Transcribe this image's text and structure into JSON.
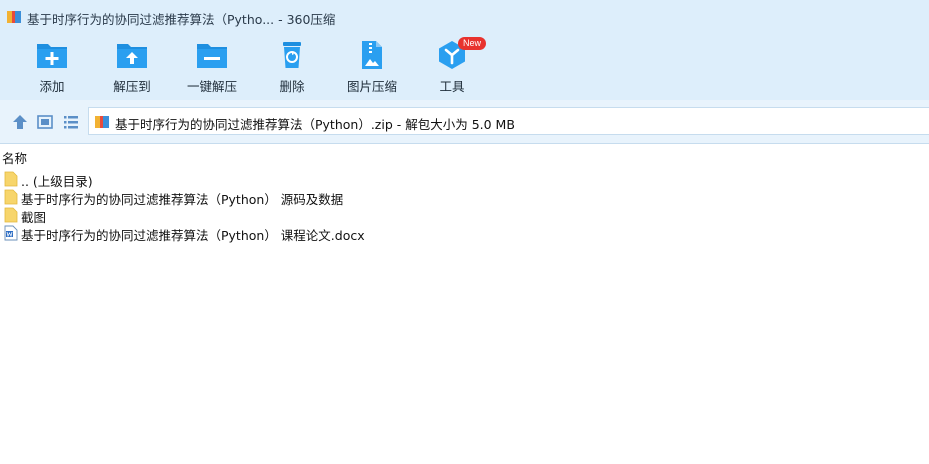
{
  "window": {
    "title": "基于时序行为的协同过滤推荐算法（Pytho... - 360压缩"
  },
  "toolbar": {
    "items": [
      {
        "label": "添加",
        "icon": "add-folder-icon"
      },
      {
        "label": "解压到",
        "icon": "extract-to-icon"
      },
      {
        "label": "一键解压",
        "icon": "one-click-extract-icon"
      },
      {
        "label": "删除",
        "icon": "trash-icon"
      },
      {
        "label": "图片压缩",
        "icon": "image-compress-icon"
      },
      {
        "label": "工具",
        "icon": "tools-icon",
        "badge": "New"
      }
    ]
  },
  "address": {
    "path": "基于时序行为的协同过滤推荐算法（Python）.zip - 解包大小为 5.0 MB"
  },
  "list": {
    "column_name": "名称",
    "rows": [
      {
        "name": ".. (上级目录)",
        "icon": "folder-icon"
      },
      {
        "name": "基于时序行为的协同过滤推荐算法（Python） 源码及数据",
        "icon": "folder-icon"
      },
      {
        "name": "截图",
        "icon": "folder-icon"
      },
      {
        "name": "基于时序行为的协同过滤推荐算法（Python） 课程论文.docx",
        "icon": "word-doc-icon"
      }
    ]
  },
  "colors": {
    "toolbar_bg": "#ddeefb",
    "icon_blue": "#1e8fe0",
    "badge_red": "#e8322e",
    "folder_yellow": "#f7d56b"
  }
}
